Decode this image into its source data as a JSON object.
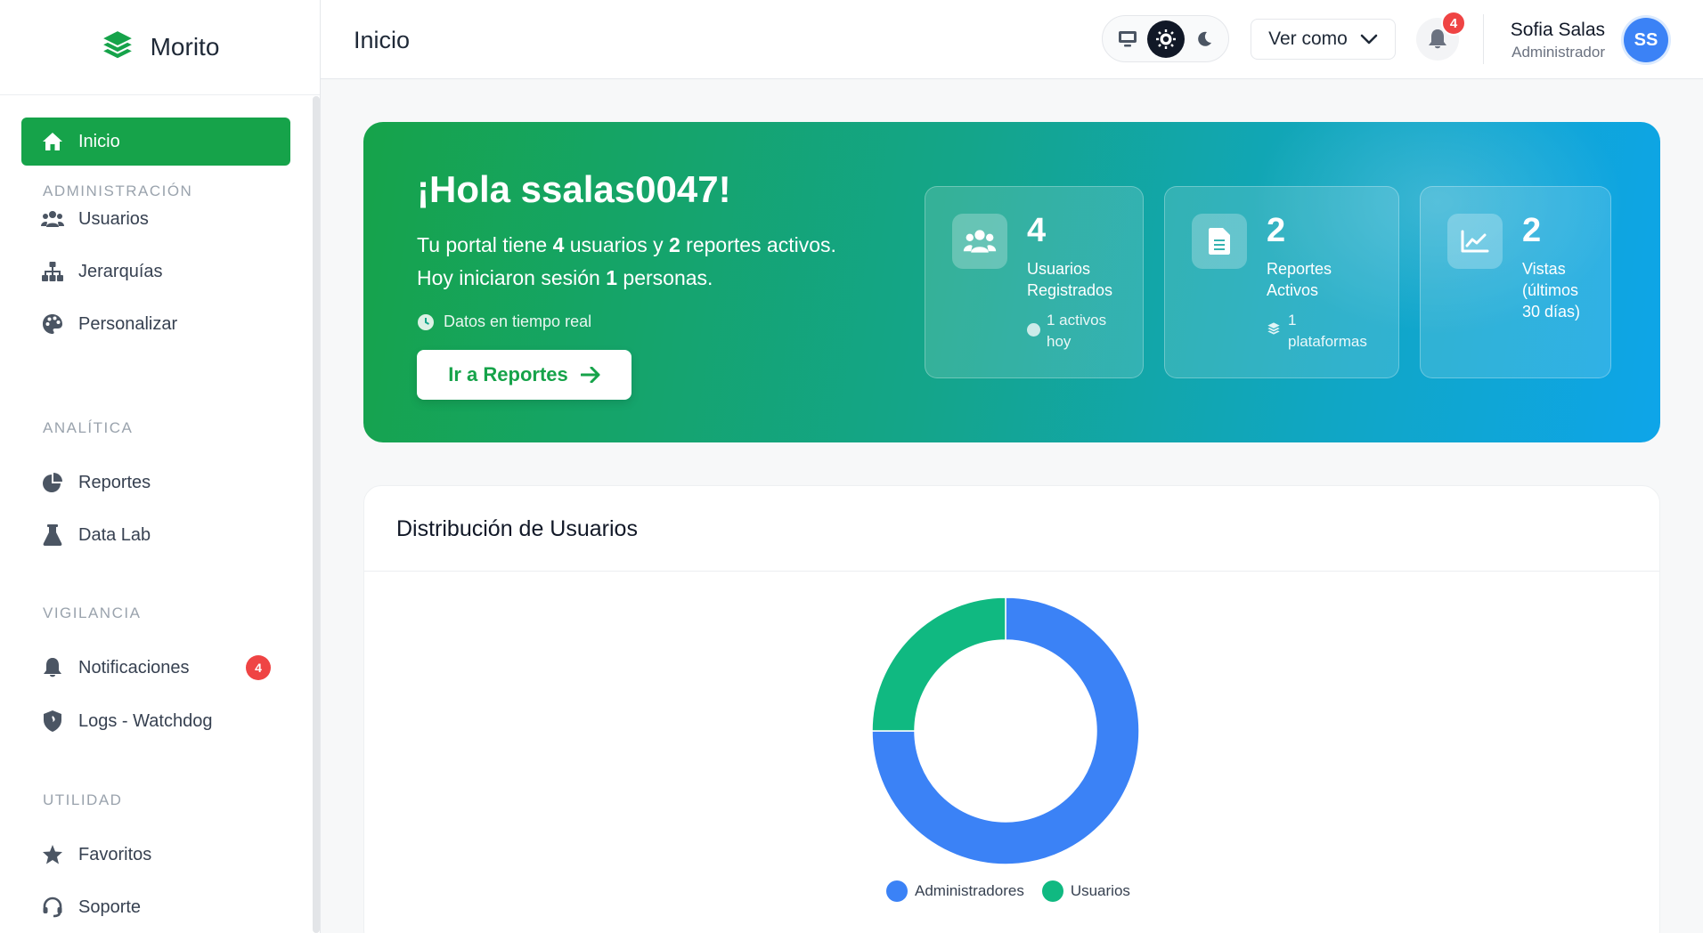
{
  "brand": {
    "name": "Morito",
    "accent": "#16a34a"
  },
  "sidebar": {
    "active": {
      "label": "Inicio",
      "icon": "home-icon"
    },
    "sections": [
      {
        "label": "ADMINISTRACIÓN",
        "items": [
          {
            "label": "Usuarios",
            "icon": "users-icon"
          },
          {
            "label": "Jerarquías",
            "icon": "sitemap-icon"
          },
          {
            "label": "Personalizar",
            "icon": "palette-icon"
          }
        ]
      },
      {
        "label": "ANALÍTICA",
        "items": [
          {
            "label": "Reportes",
            "icon": "pie-chart-icon"
          },
          {
            "label": "Data Lab",
            "icon": "flask-icon"
          }
        ]
      },
      {
        "label": "VIGILANCIA",
        "items": [
          {
            "label": "Notificaciones",
            "icon": "bell-icon",
            "badge": "4"
          },
          {
            "label": "Logs - Watchdog",
            "icon": "shield-icon"
          }
        ]
      },
      {
        "label": "UTILIDAD",
        "items": [
          {
            "label": "Favoritos",
            "icon": "star-icon"
          },
          {
            "label": "Soporte",
            "icon": "headset-icon"
          }
        ]
      }
    ]
  },
  "header": {
    "title": "Inicio",
    "view_as": "Ver como",
    "notifications_count": "4",
    "user": {
      "name": "Sofia Salas",
      "role": "Administrador",
      "initials": "SS"
    },
    "theme_modes": [
      "monitor-icon",
      "sun-icon",
      "moon-icon"
    ],
    "theme_selected": "sun-icon"
  },
  "hero": {
    "title": "¡Hola ssalas0047!",
    "line1_pre": "Tu portal tiene ",
    "line1_users": "4",
    "line1_mid": " usuarios y ",
    "line1_reports": "2",
    "line1_post": " reportes activos.",
    "line2_pre": "Hoy iniciaron sesión ",
    "line2_count": "1",
    "line2_post": " personas.",
    "realtime": "Datos en tiempo real",
    "cta": "Ir a Reportes",
    "stats": [
      {
        "value": "4",
        "label_1": "Usuarios",
        "label_2": "Registrados",
        "sub_1": "1 activos",
        "sub_2": "hoy",
        "icon": "users-icon"
      },
      {
        "value": "2",
        "label_1": "Reportes",
        "label_2": "Activos",
        "sub_1": "1",
        "sub_2": "plataformas",
        "icon": "file-icon"
      },
      {
        "value": "2",
        "label_1": "Vistas",
        "label_2": "(últimos",
        "label_3": "30 días)",
        "icon": "line-chart-icon"
      }
    ]
  },
  "chart_card": {
    "title": "Distribución de Usuarios"
  },
  "chart_data": {
    "type": "pie",
    "title": "",
    "categories": [
      "Administradores",
      "Usuarios"
    ],
    "values": [
      3,
      1
    ],
    "colors": [
      "#3b82f6",
      "#10b981"
    ],
    "legend": "bottom"
  }
}
